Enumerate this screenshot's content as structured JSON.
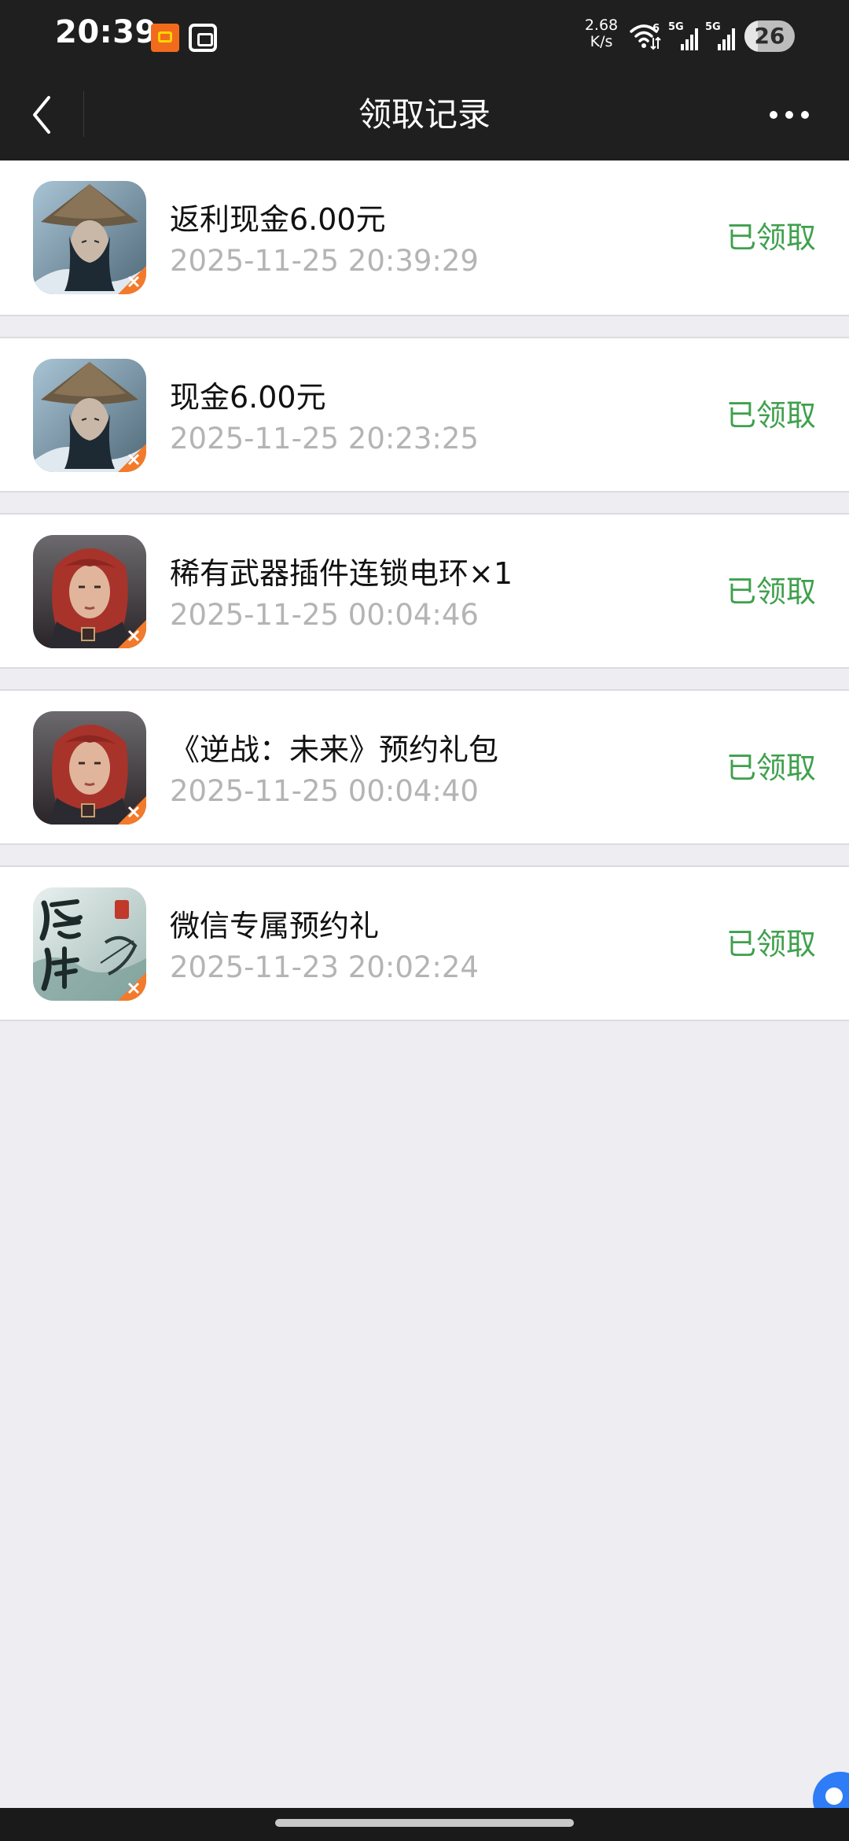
{
  "status_bar": {
    "time": "20:39",
    "net_speed_value": "2.68",
    "net_speed_unit": "K/s",
    "wifi_badge": "6",
    "signal_1_label": "5G",
    "signal_2_label": "5G",
    "battery_percent": "26",
    "battery_level": 0.26
  },
  "nav": {
    "title": "领取记录",
    "back_icon": "chevron-left-icon",
    "more_icon": "more-dots-icon"
  },
  "records": [
    {
      "title": "返利现金6.00元",
      "time": "2025-11-25 20:39:29",
      "status": "已领取",
      "icon": "game-icon-warrior-hat"
    },
    {
      "title": "现金6.00元",
      "time": "2025-11-25 20:23:25",
      "status": "已领取",
      "icon": "game-icon-warrior-hat"
    },
    {
      "title": "稀有武器插件连锁电环×1",
      "time": "2025-11-25 00:04:46",
      "status": "已领取",
      "icon": "game-icon-red-hair"
    },
    {
      "title": "《逆战：未来》预约礼包",
      "time": "2025-11-25 00:04:40",
      "status": "已领取",
      "icon": "game-icon-red-hair"
    },
    {
      "title": "微信专属预约礼",
      "time": "2025-11-23 20:02:24",
      "status": "已领取",
      "icon": "game-icon-xiuxian"
    }
  ],
  "colors": {
    "status_green": "#3fa04d",
    "header_bg": "#1f1f1f",
    "page_bg": "#ededf2"
  }
}
